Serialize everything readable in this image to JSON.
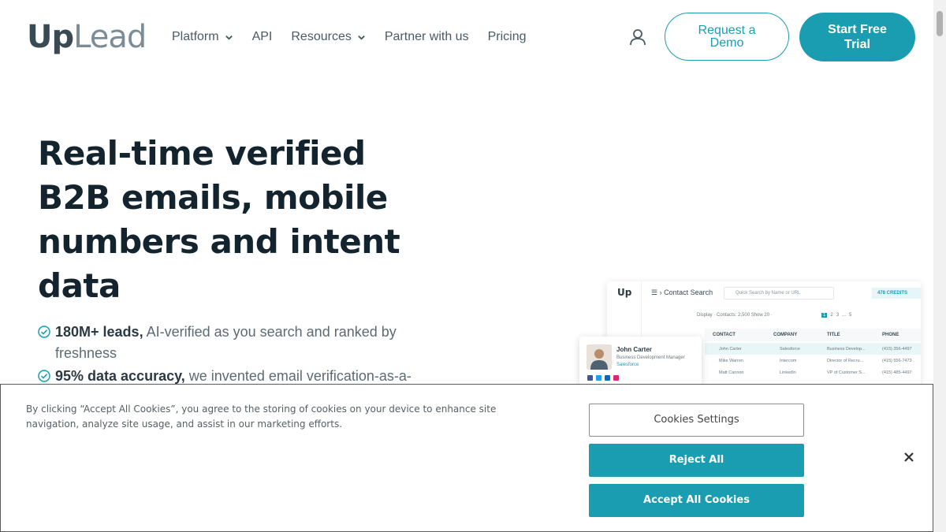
{
  "nav": {
    "logo_up": "Up",
    "logo_lead": "Lead",
    "links": [
      {
        "label": "Platform",
        "has_dropdown": true
      },
      {
        "label": "API",
        "has_dropdown": false
      },
      {
        "label": "Resources",
        "has_dropdown": true
      },
      {
        "label": "Partner with us",
        "has_dropdown": false
      },
      {
        "label": "Pricing",
        "has_dropdown": false
      }
    ],
    "user_icon": "user-icon",
    "demo_label": "Request a Demo",
    "trial_label": "Start Free Trial"
  },
  "hero": {
    "title": "Real-time verified B2B emails, mobile numbers and intent data",
    "bullets": [
      {
        "bold": "180M+ leads,",
        "text": " AI-verified as you search and ranked by freshness"
      },
      {
        "bold": "95% data accuracy,",
        "text": " we invented email verification-as-a-"
      }
    ]
  },
  "mockup": {
    "logo": "Up",
    "header": "Contact Search",
    "search_placeholder": "Quick Search by Name or URL",
    "credits": "478 CREDITS",
    "toolbar": "Display ·     Contacts: 2,500    Show  20 ·",
    "pages": [
      "1",
      "2",
      "3",
      "...",
      "5"
    ],
    "columns": [
      "CONTACT",
      "COMPANY",
      "TITLE",
      "PHONE"
    ],
    "rows": [
      [
        "John Carter",
        "Salesforce",
        "Business Develop...",
        "(415) 356-4497"
      ],
      [
        "Mike Warren",
        "Intercom",
        "Director of Recru...",
        "(415) 556-7473"
      ],
      [
        "Matt Cannon",
        "LinkedIn",
        "VP of Customer S...",
        "(415) 485-4497"
      ]
    ],
    "card": {
      "name": "John Carter",
      "role": "Business Development Manager",
      "company": "Salesforce"
    }
  },
  "cookie": {
    "text": "By clicking “Accept All Cookies”, you agree to the storing of cookies on your device to enhance site navigation, analyze site usage, and assist in our marketing efforts.",
    "settings_label": "Cookies Settings",
    "reject_label": "Reject All",
    "accept_label": "Accept All Cookies"
  },
  "colors": {
    "brand": "#1a9db1",
    "heading": "#14242e"
  }
}
